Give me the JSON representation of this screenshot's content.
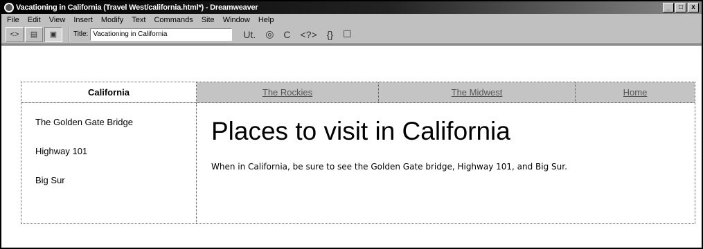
{
  "window": {
    "title": "Vacationing in California (Travel West/california.html*) - Dreamweaver",
    "buttons": [
      "_",
      "□",
      "x"
    ]
  },
  "menu": [
    "File",
    "Edit",
    "View",
    "Insert",
    "Modify",
    "Text",
    "Commands",
    "Site",
    "Window",
    "Help"
  ],
  "toolbar": {
    "title_label": "Title:",
    "title_value": "Vacationing in California",
    "view_buttons": [
      "code-view-icon",
      "split-view-icon",
      "design-view-icon"
    ],
    "icons": [
      "Ut.",
      "◎",
      "C",
      "<?>",
      "{}",
      "☐"
    ]
  },
  "nav": {
    "items": [
      {
        "label": "California",
        "current": true
      },
      {
        "label": "The Rockies",
        "current": false
      },
      {
        "label": "The Midwest",
        "current": false
      },
      {
        "label": "Home",
        "current": false
      }
    ]
  },
  "sidebar": {
    "items": [
      "The Golden Gate Bridge",
      "Highway 101",
      "Big Sur"
    ]
  },
  "main": {
    "heading": "Places to visit in California",
    "text": "When in California, be sure to see the Golden Gate bridge, Highway 101, and Big Sur."
  }
}
